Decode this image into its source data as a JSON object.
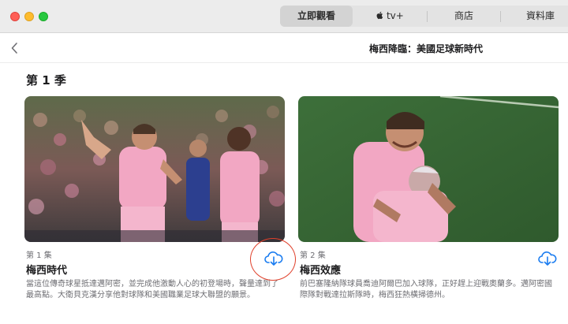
{
  "window": {
    "tabs": [
      {
        "label": "立即觀看",
        "active": true
      },
      {
        "label": "tv+",
        "active": false
      },
      {
        "label": "商店",
        "active": false
      },
      {
        "label": "資料庫",
        "active": false
      }
    ]
  },
  "nav": {
    "title": "梅西降臨：美國足球新時代"
  },
  "season": {
    "label": "第 1 季"
  },
  "episodes": [
    {
      "number": "第 1 集",
      "title": "梅西時代",
      "description": "當這位傳奇球星抵達邁阿密，並完成他激動人心的初登場時，聲量達到了最高點。大衛貝克漢分享他對球隊和美國職業足球大聯盟的願景。",
      "download_icon": "cloud-download-icon"
    },
    {
      "number": "第 2 集",
      "title": "梅西效應",
      "description": "前巴塞隆納隊球員喬迪阿爾巴加入球隊，正好趕上迎戰奧蘭多。邁阿密國際隊對戰達拉斯隊時，梅西狂熱橫掃德州。",
      "download_icon": "cloud-download-icon"
    }
  ],
  "colors": {
    "accent": "#1a7cf0",
    "highlight_ring": "#e0402b",
    "pink_jersey": "#f2a7c3"
  }
}
